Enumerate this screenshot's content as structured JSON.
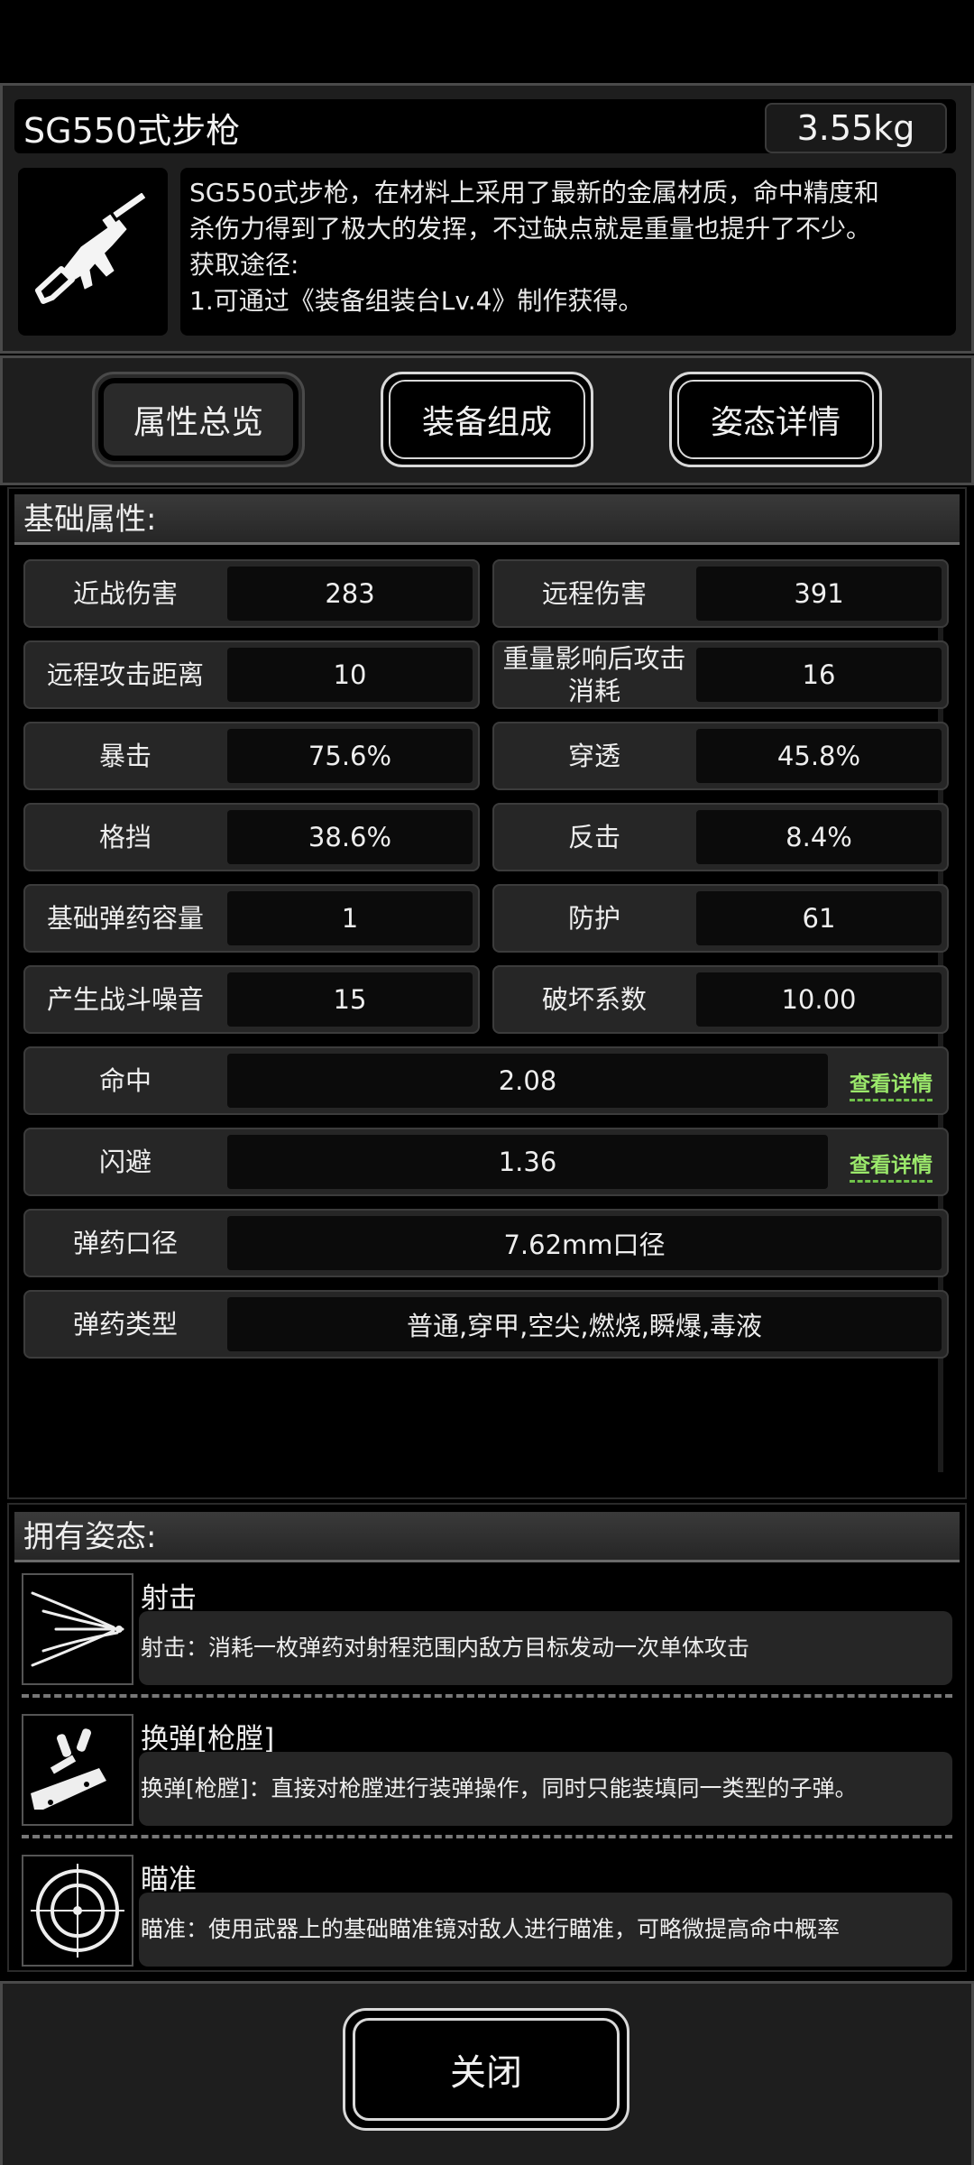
{
  "weapon": {
    "name": "SG550式步枪",
    "weight": "3.55kg",
    "icon": "rifle-icon",
    "description": [
      "SG550式步枪，在材料上采用了最新的金属材质，命中精度和",
      "杀伤力得到了极大的发挥，不过缺点就是重量也提升了不少。",
      "获取途径:",
      "1.可通过《装备组装台Lv.4》制作获得。"
    ]
  },
  "tabs": {
    "overview": "属性总览",
    "components": "装备组成",
    "stances": "姿态详情"
  },
  "basic": {
    "title": "基础属性:",
    "stats": [
      {
        "label": "近战伤害",
        "value": "283"
      },
      {
        "label": "远程伤害",
        "value": "391"
      },
      {
        "label": "远程攻击距离",
        "value": "10"
      },
      {
        "label": "重量影响后攻击消耗",
        "value": "16"
      },
      {
        "label": "暴击",
        "value": "75.6%"
      },
      {
        "label": "穿透",
        "value": "45.8%"
      },
      {
        "label": "格挡",
        "value": "38.6%"
      },
      {
        "label": "反击",
        "value": "8.4%"
      },
      {
        "label": "基础弹药容量",
        "value": "1"
      },
      {
        "label": "防护",
        "value": "61"
      },
      {
        "label": "产生战斗噪音",
        "value": "15"
      },
      {
        "label": "破坏系数",
        "value": "10.00"
      }
    ],
    "wide": [
      {
        "label": "命中",
        "value": "2.08",
        "link": "查看详情"
      },
      {
        "label": "闪避",
        "value": "1.36",
        "link": "查看详情"
      },
      {
        "label": "弹药口径",
        "value": "7.62mm口径"
      },
      {
        "label": "弹药类型",
        "value": "普通,穿甲,空尖,燃烧,瞬爆,毒液"
      }
    ]
  },
  "stances": {
    "title": "拥有姿态:",
    "items": [
      {
        "name": "射击",
        "desc": "射击：消耗一枚弹药对射程范围内敌方目标发动一次单体攻击",
        "icon": "shoot-icon"
      },
      {
        "name": "换弹[枪膛]",
        "desc": "换弹[枪膛]：直接对枪膛进行装弹操作，同时只能装填同一类型的子弹。",
        "icon": "reload-icon"
      },
      {
        "name": "瞄准",
        "desc": "瞄准：使用武器上的基础瞄准镜对敌人进行瞄准，可略微提高命中概率",
        "icon": "crosshair-icon"
      }
    ]
  },
  "close_label": "关闭"
}
